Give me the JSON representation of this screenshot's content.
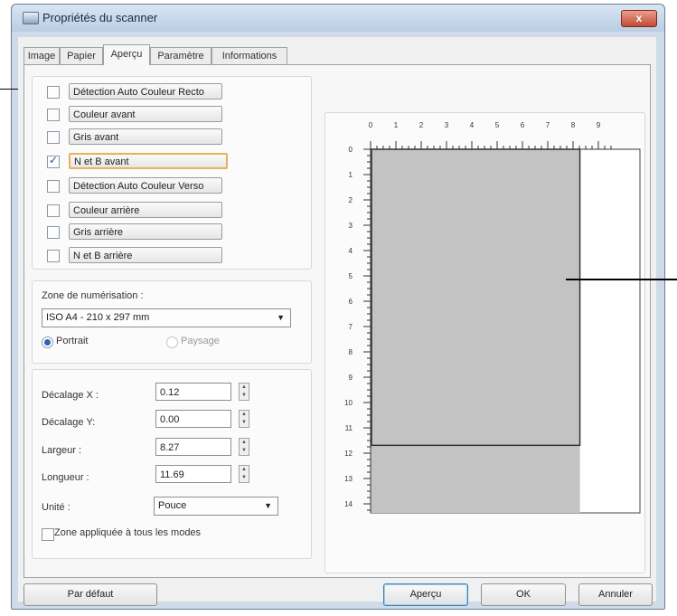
{
  "window": {
    "title": "Propriétés du scanner",
    "close_glyph": "x"
  },
  "tabs": [
    {
      "label": "Image",
      "active": false
    },
    {
      "label": "Papier",
      "active": false
    },
    {
      "label": "Aperçu",
      "active": true
    },
    {
      "label": "Paramètre",
      "active": false
    },
    {
      "label": "Informations",
      "active": false
    }
  ],
  "modes": [
    {
      "label": "Détection Auto Couleur Recto",
      "checked": false
    },
    {
      "label": "Couleur avant",
      "checked": false
    },
    {
      "label": "Gris avant",
      "checked": false
    },
    {
      "label": "N et B avant",
      "checked": true,
      "selected": true
    },
    {
      "label": "Détection Auto Couleur Verso",
      "checked": false
    },
    {
      "label": "Couleur arrière",
      "checked": false
    },
    {
      "label": "Gris arrière",
      "checked": false
    },
    {
      "label": "N et B arrière",
      "checked": false
    }
  ],
  "scan_zone": {
    "label": "Zone de numérisation :",
    "selected": "ISO A4 - 210 x 297 mm",
    "orientation": {
      "portrait": "Portrait",
      "landscape": "Paysage",
      "value": "Portrait"
    }
  },
  "fields": [
    {
      "label": "Décalage X :",
      "value": "0.12"
    },
    {
      "label": "Décalage Y:",
      "value": "0.00"
    },
    {
      "label": "Largeur :",
      "value": "8.27"
    },
    {
      "label": "Longueur :",
      "value": "11.69"
    }
  ],
  "unit": {
    "label": "Unité :",
    "value": "Pouce"
  },
  "apply_all": {
    "label": "Zone appliquée à tous les modes",
    "checked": false
  },
  "ruler": {
    "x_labels": [
      "0",
      "1",
      "2",
      "3",
      "4",
      "5",
      "6",
      "7",
      "8",
      "9"
    ],
    "y_labels": [
      "0",
      "1",
      "2",
      "3",
      "4",
      "5",
      "6",
      "7",
      "8",
      "9",
      "10",
      "11",
      "12",
      "13",
      "14"
    ],
    "scan_area": {
      "width_in": 8.27,
      "length_in": 11.69
    }
  },
  "buttons": {
    "default": "Par défaut",
    "preview": "Aperçu",
    "ok": "OK",
    "cancel": "Annuler"
  },
  "colors": {
    "title_bg": "#c6d7ea",
    "close_bg": "#c9503a",
    "selection_border": "#e7b25b",
    "preview_gray": "#c3c3c3"
  }
}
